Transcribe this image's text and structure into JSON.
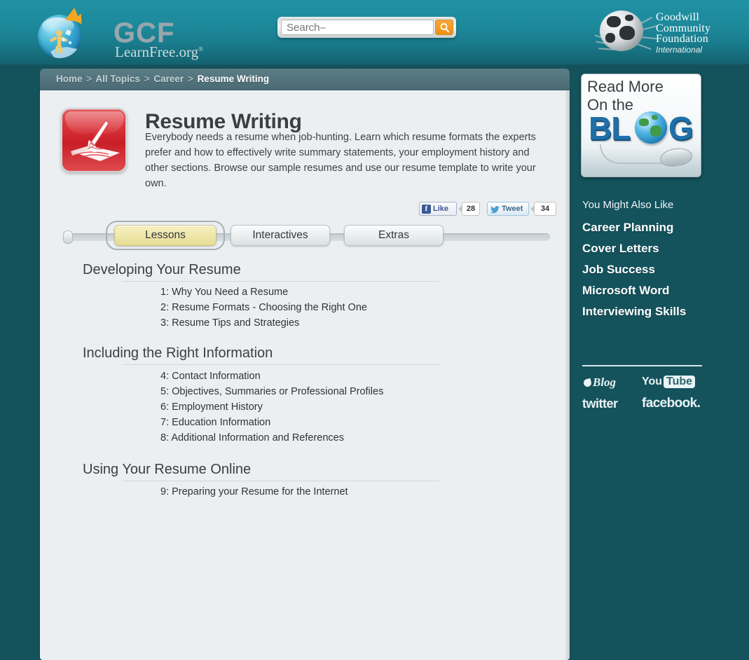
{
  "header": {
    "logo": {
      "brand_top": "GCF",
      "brand_bottom": "LearnFree.org",
      "registered_mark": "®"
    },
    "search": {
      "placeholder": "Search–",
      "value": "",
      "button_icon": "search-icon"
    },
    "partner": {
      "line1": "Goodwill",
      "line2": "Community",
      "line3": "Foundation",
      "line4": "International"
    }
  },
  "breadcrumb": {
    "items": [
      {
        "label": "Home",
        "current": false
      },
      {
        "label": "All Topics",
        "current": false
      },
      {
        "label": "Career",
        "current": false
      },
      {
        "label": "Resume Writing",
        "current": true
      }
    ],
    "separator": ">"
  },
  "course": {
    "icon": "resume-writing-icon",
    "title": "Resume Writing",
    "description": "Everybody needs a resume when job-hunting. Learn which resume formats the experts prefer and how to effectively write summary statements, your employment history and other sections. Browse our sample resumes and use our resume template to write your own."
  },
  "social_bar": {
    "facebook": {
      "label": "Like",
      "count": "28",
      "icon": "facebook-icon"
    },
    "twitter": {
      "label": "Tweet",
      "count": "34",
      "icon": "twitter-bird-icon"
    }
  },
  "tabs": [
    {
      "label": "Lessons",
      "active": true
    },
    {
      "label": "Interactives",
      "active": false
    },
    {
      "label": "Extras",
      "active": false
    }
  ],
  "sections": [
    {
      "heading": "Developing Your Resume",
      "lessons": [
        "1: Why You Need a Resume",
        "2: Resume Formats - Choosing the Right One",
        "3: Resume Tips and Strategies"
      ]
    },
    {
      "heading": "Including the Right Information",
      "lessons": [
        "4: Contact Information",
        "5: Objectives, Summaries or Professional Profiles",
        "6: Employment History",
        "7: Education Information",
        "8: Additional Information and References"
      ]
    },
    {
      "heading": "Using Your Resume Online",
      "lessons": [
        "9: Preparing your Resume for the Internet"
      ]
    }
  ],
  "sidebar": {
    "blog_card": {
      "line1": "Read More",
      "line2": "On the",
      "word_left": "BL",
      "word_right": "G",
      "full_word": "BLOG"
    },
    "also_like_title": "You Might Also Like",
    "also_like_links": [
      "Career Planning",
      "Cover Letters",
      "Job Success",
      "Microsoft Word",
      "Interviewing Skills"
    ],
    "social_links": [
      {
        "label": "Blog",
        "icon": "blog-icon"
      },
      {
        "label": "You",
        "label2": "Tube",
        "icon": "youtube-icon"
      },
      {
        "label": "twitter",
        "icon": "twitter-icon"
      },
      {
        "label": "facebook.",
        "icon": "facebook-wordmark-icon"
      }
    ]
  },
  "colors": {
    "page_background": "#14525c",
    "banner_top": "#2191a4",
    "breadcrumb_bar": "#4f7079",
    "panel": "#eceff1",
    "accent_orange": "#ef8f14",
    "active_tab": "#efe7ab",
    "icon_red": "#d93239",
    "blog_blue": "#1f6fa8"
  }
}
